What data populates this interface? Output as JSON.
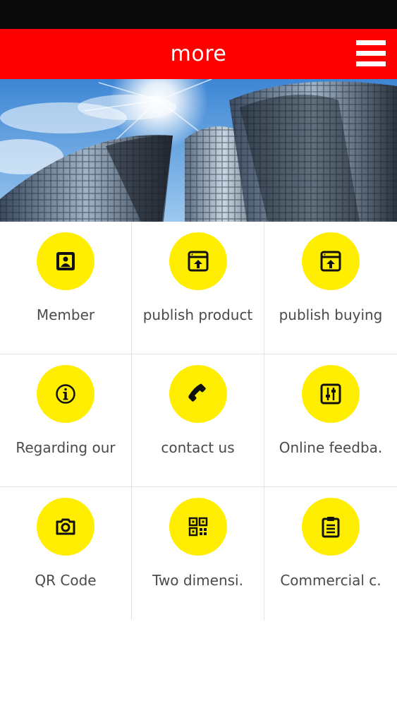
{
  "header": {
    "title": "more"
  },
  "colors": {
    "header_bg": "#ff0000",
    "icon_circle": "#ffee00",
    "label_text": "#4a4a4a"
  },
  "grid": {
    "items": [
      {
        "label": "Member",
        "icon": "member-card-icon"
      },
      {
        "label": "publish product",
        "icon": "upload-window-icon"
      },
      {
        "label": "publish buying",
        "icon": "upload-window-icon"
      },
      {
        "label": "Regarding our",
        "icon": "info-icon"
      },
      {
        "label": "contact us",
        "icon": "phone-icon"
      },
      {
        "label": "Online feedba.",
        "icon": "sliders-icon"
      },
      {
        "label": "QR Code",
        "icon": "camera-icon"
      },
      {
        "label": "Two dimensi.",
        "icon": "qr-code-icon"
      },
      {
        "label": "Commercial c.",
        "icon": "clipboard-icon"
      }
    ]
  }
}
